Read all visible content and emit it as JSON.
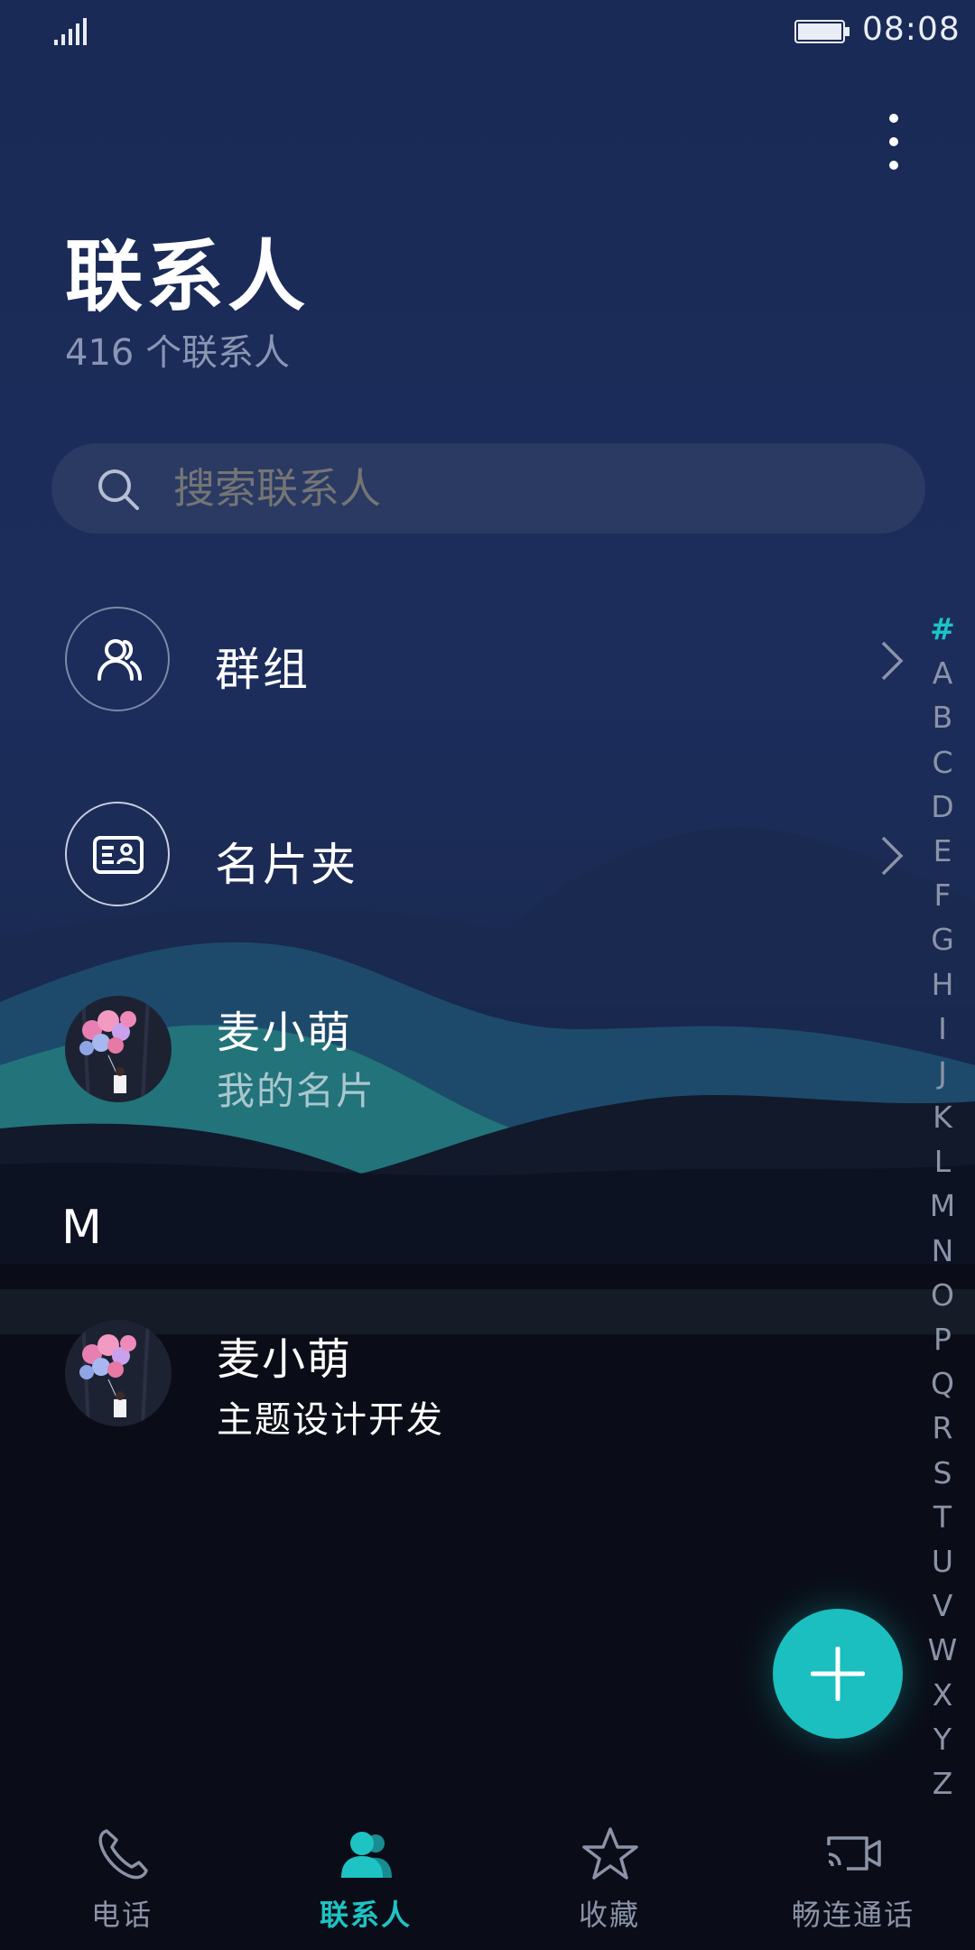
{
  "status_bar": {
    "time": "08:08"
  },
  "header": {
    "title": "联系人",
    "count": "416 个联系人"
  },
  "search": {
    "placeholder": "搜索联系人"
  },
  "list": {
    "groups_label": "群组",
    "card_holder_label": "名片夹",
    "my_card": {
      "name": "麦小萌",
      "subtitle": "我的名片"
    },
    "section_letter": "M",
    "contacts": [
      {
        "name": "麦小萌",
        "subtitle": "主题设计开发"
      }
    ]
  },
  "alphabet_index": [
    "#",
    "A",
    "B",
    "C",
    "D",
    "E",
    "F",
    "G",
    "H",
    "I",
    "J",
    "K",
    "L",
    "M",
    "N",
    "O",
    "P",
    "Q",
    "R",
    "S",
    "T",
    "U",
    "V",
    "W",
    "X",
    "Y",
    "Z"
  ],
  "alphabet_active": "#",
  "bottom_nav": {
    "tabs": [
      {
        "label": "电话",
        "icon": "phone-icon",
        "active": false
      },
      {
        "label": "联系人",
        "icon": "contacts-icon",
        "active": true
      },
      {
        "label": "收藏",
        "icon": "star-icon",
        "active": false
      },
      {
        "label": "畅连通话",
        "icon": "video-call-icon",
        "active": false
      }
    ]
  },
  "colors": {
    "accent": "#1ec3c4",
    "background_top": "#1a2a56",
    "background_bottom": "#0a0d17"
  }
}
